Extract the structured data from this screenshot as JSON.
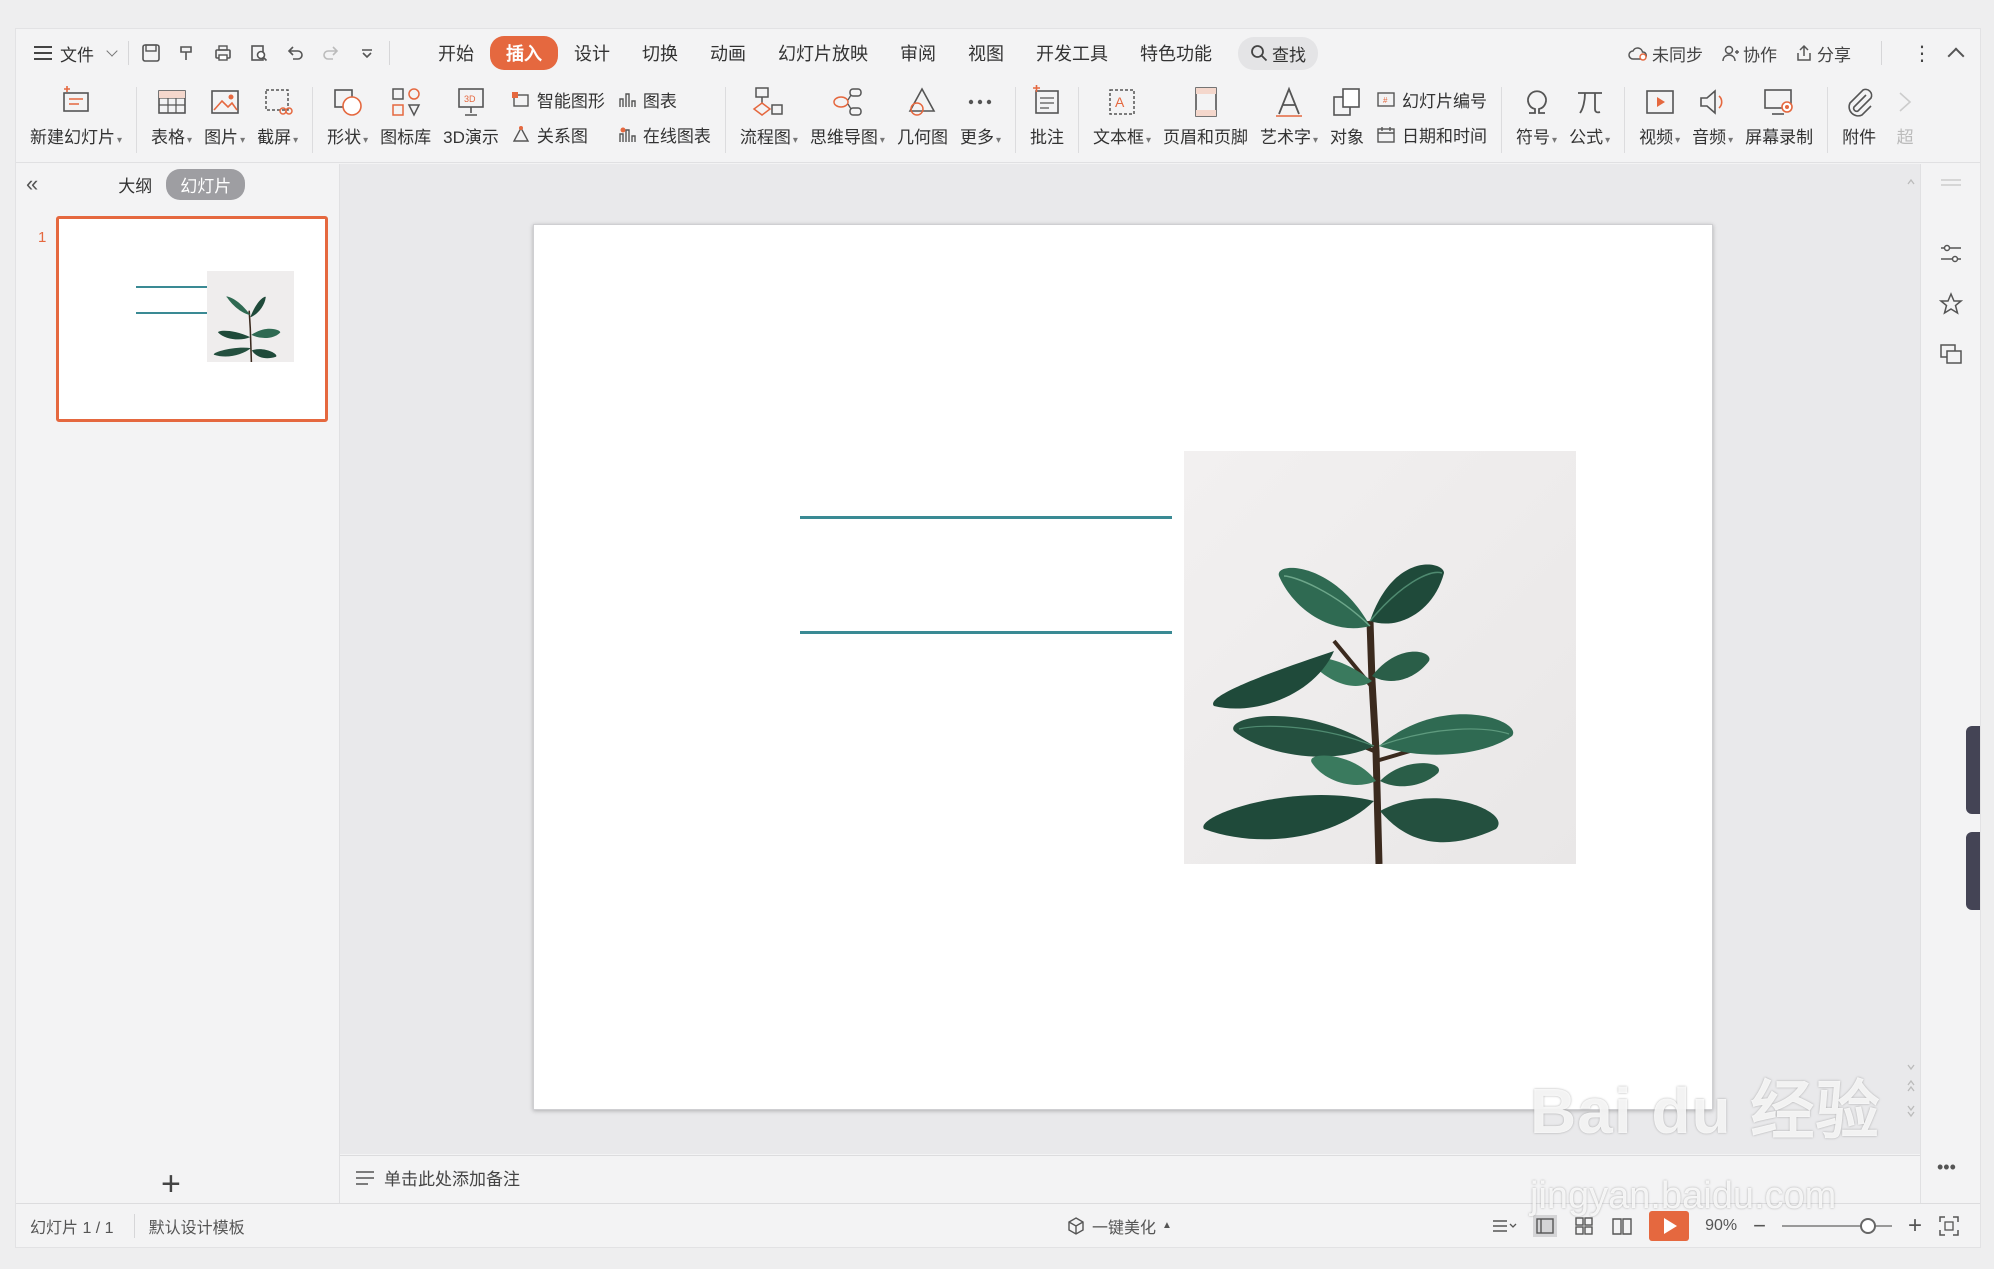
{
  "menubar": {
    "file_label": "文件",
    "tabs": [
      "开始",
      "插入",
      "设计",
      "切换",
      "动画",
      "幻灯片放映",
      "审阅",
      "视图",
      "开发工具",
      "特色功能"
    ],
    "active_tab": "插入",
    "search_label": "查找",
    "right": {
      "sync_label": "未同步",
      "collab_label": "协作",
      "share_label": "分享"
    }
  },
  "ribbon": {
    "new_slide": "新建幻灯片",
    "table": "表格",
    "picture": "图片",
    "screenshot": "截屏",
    "shape": "形状",
    "icon_lib": "图标库",
    "demo3d": "3D演示",
    "smart_art": "智能图形",
    "chart": "图表",
    "relation": "关系图",
    "online_chart": "在线图表",
    "flowchart": "流程图",
    "mindmap": "思维导图",
    "geometry": "几何图",
    "more": "更多",
    "comment": "批注",
    "textbox": "文本框",
    "header_footer": "页眉和页脚",
    "wordart": "艺术字",
    "object": "对象",
    "slide_number": "幻灯片编号",
    "datetime": "日期和时间",
    "symbol": "符号",
    "formula": "公式",
    "video": "视频",
    "audio": "音频",
    "screen_record": "屏幕录制",
    "attachment": "附件",
    "overflow": "超"
  },
  "leftpane": {
    "outline_tab": "大纲",
    "slides_tab": "幻灯片",
    "slide_number": "1"
  },
  "notes": {
    "placeholder": "单击此处添加备注"
  },
  "statusbar": {
    "slide_count": "幻灯片 1 / 1",
    "template": "默认设计模板",
    "beautify": "一键美化",
    "zoom": "90%"
  },
  "watermark": {
    "brand": "Bai du 经验",
    "url": "jingyan.baidu.com"
  },
  "colors": {
    "accent": "#e5683f",
    "line": "#3a8a94",
    "leaf_dark": "#1f4a3a",
    "leaf_mid": "#2f6a52"
  }
}
